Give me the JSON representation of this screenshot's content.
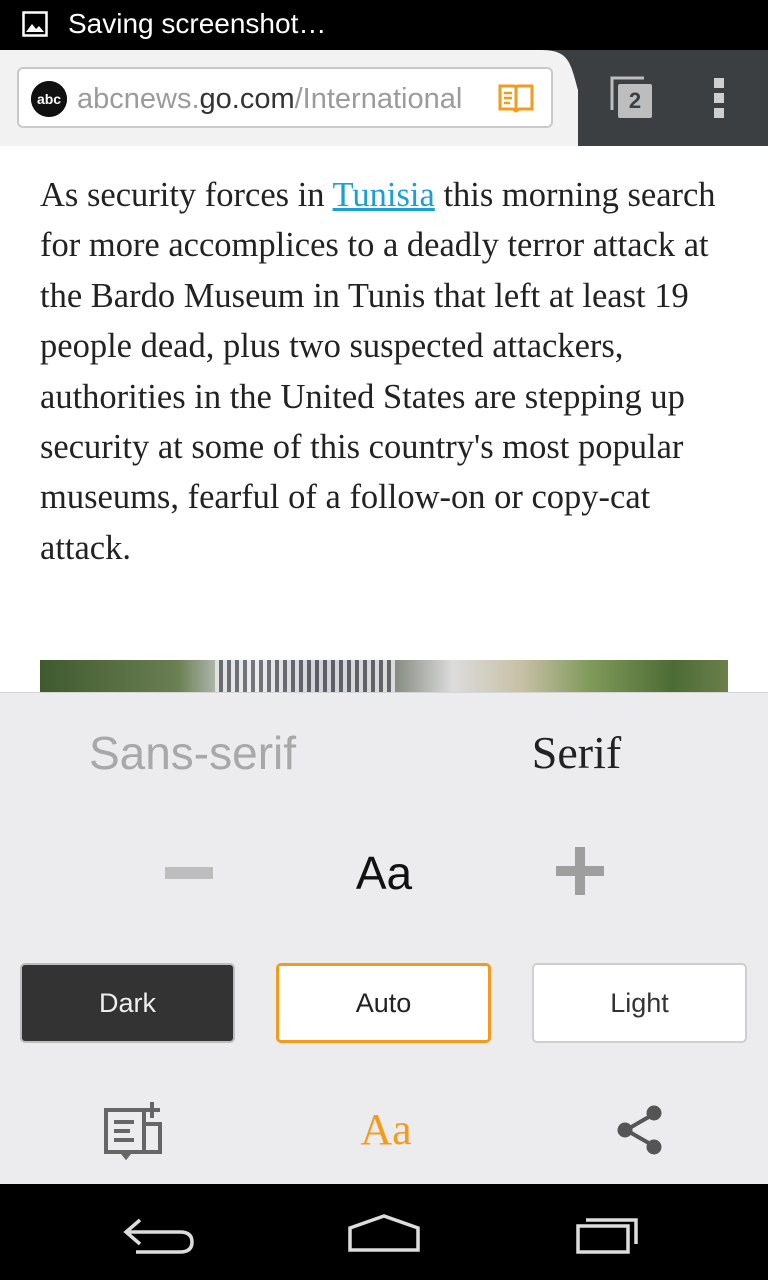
{
  "status_bar": {
    "notification_icon": "image-icon",
    "text": "Saving screenshot…"
  },
  "toolbar": {
    "url": {
      "prefix": "abcnews.",
      "domain": "go.com",
      "path": "/International",
      "site_logo_icon": "abc-logo-icon",
      "site_logo_text": "abc"
    },
    "reader_mode_icon": "reader-mode-icon",
    "tab_count": "2",
    "menu_icon": "overflow-menu-icon"
  },
  "article": {
    "text_before_link": "As security forces in ",
    "link_text": "Tunisia",
    "text_after_link": " this morning search for more accomplices to a deadly terror attack at the Bardo Museum in Tunis that left at least 19 people dead, plus two suspected attackers, authorities in the United States are stepping up security at some of this country's most popular museums, fearful of a follow-on or copy-cat attack."
  },
  "reader_settings": {
    "font_options": {
      "sans": "Sans-serif",
      "serif": "Serif",
      "selected": "Serif"
    },
    "size_sample": "Aa",
    "themes": {
      "dark": "Dark",
      "auto": "Auto",
      "light": "Light",
      "selected": "Auto"
    },
    "bottom_actions": {
      "reading_list_icon": "add-to-reading-list-icon",
      "text_settings_label": "Aa",
      "share_icon": "share-icon"
    },
    "accent_color": "#f29b1d"
  },
  "nav_bar": {
    "back_icon": "back-icon",
    "home_icon": "home-icon",
    "recents_icon": "recents-icon"
  }
}
